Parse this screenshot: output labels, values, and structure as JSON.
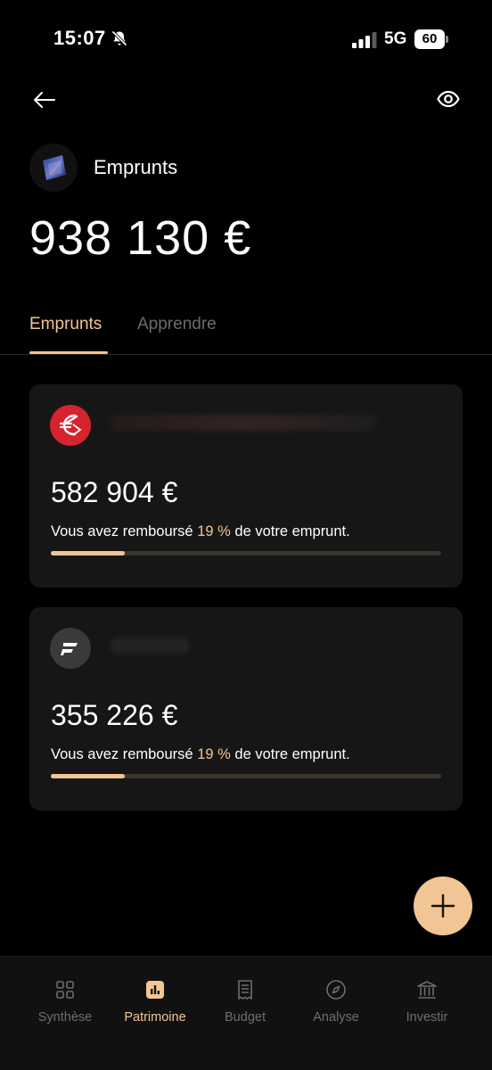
{
  "status_bar": {
    "time": "15:07",
    "network": "5G",
    "battery": "60"
  },
  "header": {
    "back_icon": "arrow-left-icon",
    "visibility_icon": "eye-icon"
  },
  "title": {
    "label": "Emprunts",
    "total": "938 130 €"
  },
  "tabs": [
    {
      "label": "Emprunts",
      "active": true
    },
    {
      "label": "Apprendre",
      "active": false
    }
  ],
  "loans": [
    {
      "amount": "582 904 €",
      "progress_prefix": "Vous avez remboursé",
      "progress_pct_text": "19 %",
      "progress_suffix": "de votre emprunt.",
      "progress": 0.19,
      "logo_color": "#d5232f"
    },
    {
      "amount": "355 226 €",
      "progress_prefix": "Vous avez remboursé",
      "progress_pct_text": "19 %",
      "progress_suffix": "de votre emprunt.",
      "progress": 0.19,
      "logo_color": "#3a3a3c"
    }
  ],
  "nav": [
    {
      "label": "Synthèse",
      "icon": "grid-icon",
      "active": false
    },
    {
      "label": "Patrimoine",
      "icon": "bar-chart-icon",
      "active": true
    },
    {
      "label": "Budget",
      "icon": "receipt-icon",
      "active": false
    },
    {
      "label": "Analyse",
      "icon": "compass-icon",
      "active": false
    },
    {
      "label": "Investir",
      "icon": "bank-icon",
      "active": false
    }
  ],
  "colors": {
    "accent": "#f2c595",
    "background": "#000000",
    "card": "#161616"
  }
}
